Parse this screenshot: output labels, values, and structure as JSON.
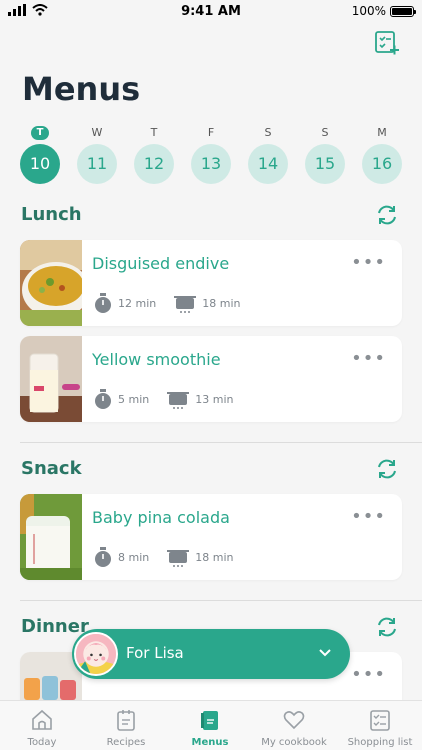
{
  "status": {
    "time": "9:41 AM",
    "battery": "100%"
  },
  "header": {
    "title": "Menus",
    "add_icon": "add-menu-icon"
  },
  "days": [
    {
      "dow": "T",
      "num": "10",
      "active": true
    },
    {
      "dow": "W",
      "num": "11",
      "active": false
    },
    {
      "dow": "T",
      "num": "12",
      "active": false
    },
    {
      "dow": "F",
      "num": "13",
      "active": false
    },
    {
      "dow": "S",
      "num": "14",
      "active": false
    },
    {
      "dow": "S",
      "num": "15",
      "active": false
    },
    {
      "dow": "M",
      "num": "16",
      "active": false
    }
  ],
  "sections": {
    "lunch": {
      "title": "Lunch",
      "items": [
        {
          "name": "Disguised endive",
          "prep": "12 min",
          "cook": "18 min"
        },
        {
          "name": "Yellow smoothie",
          "prep": "5 min",
          "cook": "13 min"
        }
      ]
    },
    "snack": {
      "title": "Snack",
      "items": [
        {
          "name": "Baby pina colada",
          "prep": "8 min",
          "cook": "18 min"
        }
      ]
    },
    "dinner": {
      "title": "Dinner"
    }
  },
  "more_label": "•••",
  "profile": {
    "label": "For Lisa"
  },
  "tabs": [
    {
      "label": "Today",
      "active": false
    },
    {
      "label": "Recipes",
      "active": false
    },
    {
      "label": "Menus",
      "active": true
    },
    {
      "label": "My cookbook",
      "active": false
    },
    {
      "label": "Shopping list",
      "active": false
    }
  ],
  "colors": {
    "accent": "#2aa78c",
    "accent_light": "#cfeae5",
    "section": "#2a7665"
  }
}
